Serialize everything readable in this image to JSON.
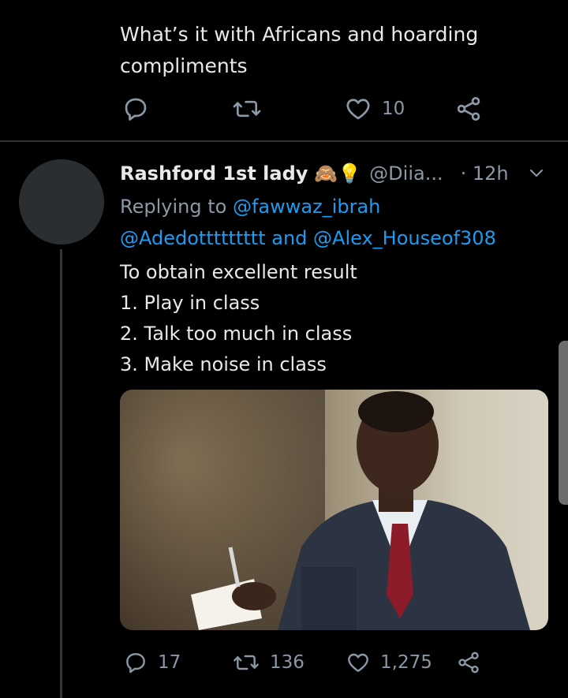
{
  "top_tweet": {
    "text_line1": "What’s it with Africans and hoarding",
    "text_line2": "compliments",
    "reply_count": "",
    "retweet_count": "",
    "like_count": "10"
  },
  "tweet": {
    "display_name": "Rashford 1st lady",
    "emoji": "🙈💡",
    "handle": "@Diia...",
    "time": "· 12h",
    "replying_prefix": "Replying to",
    "reply_to_1": "@fawwaz_ibrah",
    "reply_to_2": "@Adedottttttttt",
    "reply_and": "and",
    "reply_to_3": "@Alex_Houseof308",
    "lines": [
      "To obtain excellent result",
      "1. Play in class",
      "2. Talk too much in class",
      "3. Make noise in class"
    ],
    "reply_count": "17",
    "retweet_count": "136",
    "like_count": "1,275"
  },
  "icons": {
    "reply": "reply-icon",
    "retweet": "retweet-icon",
    "like": "heart-icon",
    "share": "share-icon",
    "more": "chevron-down-icon"
  },
  "colors": {
    "background": "#000000",
    "text": "#e7e9ea",
    "muted": "#8b98a5",
    "link": "#1d9bf0",
    "divider": "#2f3336"
  }
}
